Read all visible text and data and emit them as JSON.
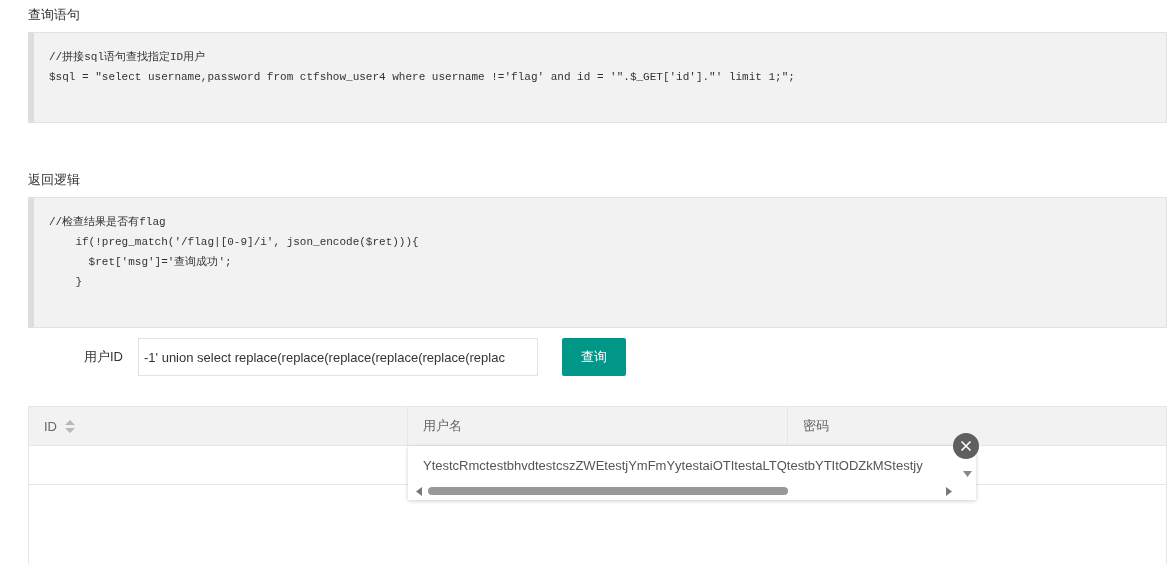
{
  "sections": [
    {
      "title": "查询语句",
      "code": [
        "//拼接sql语句查找指定ID用户",
        "$sql = \"select username,password from ctfshow_user4 where username !='flag' and id = '\".$_GET['id'].\"' limit 1;\";"
      ]
    },
    {
      "title": "返回逻辑",
      "code": [
        "//检查结果是否有flag",
        "    if(!preg_match('/flag|[0-9]/i', json_encode($ret))){",
        "      $ret['msg']='查询成功';",
        "    }"
      ]
    }
  ],
  "form": {
    "label": "用户ID",
    "value": "-1' union select replace(replace(replace(replace(replace(replac",
    "button": "查询"
  },
  "table": {
    "columns": [
      {
        "label": "ID",
        "sortable": true
      },
      {
        "label": "用户名",
        "sortable": false
      },
      {
        "label": "密码",
        "sortable": false
      }
    ],
    "expanded_cell": {
      "text": "YtestcRmctestbhvdtestcszZWEtestjYmFmYytestaiOTItestaLTQtestbYTItODZkMStestjy"
    }
  }
}
